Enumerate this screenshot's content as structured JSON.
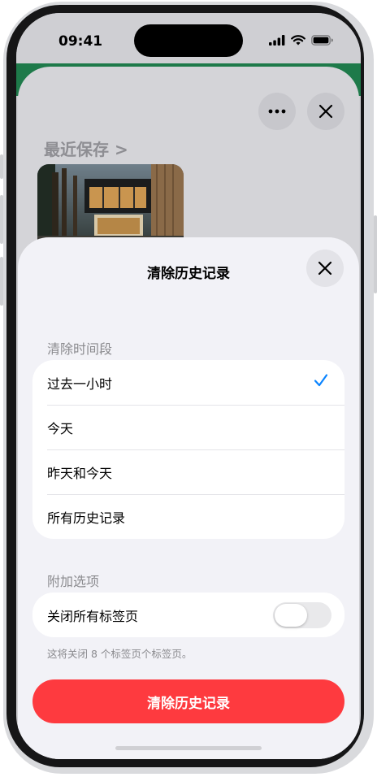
{
  "status_bar": {
    "time": "09:41"
  },
  "background_page": {
    "recent_saves_link": "最近保存 >"
  },
  "sheet": {
    "title": "清除历史记录",
    "timeframe_label": "清除时间段",
    "timeframe_options": [
      {
        "label": "过去一小时",
        "selected": true
      },
      {
        "label": "今天",
        "selected": false
      },
      {
        "label": "昨天和今天",
        "selected": false
      },
      {
        "label": "所有历史记录",
        "selected": false
      }
    ],
    "additional_label": "附加选项",
    "close_tabs_label": "关闭所有标签页",
    "close_tabs_enabled": false,
    "close_tabs_footnote": "这将关闭 8 个标签页个标签页。",
    "clear_button": "清除历史记录"
  },
  "colors": {
    "accent": "#0a84ff",
    "destructive": "#fe3a3f",
    "sheet_background": "#f2f2f7"
  }
}
